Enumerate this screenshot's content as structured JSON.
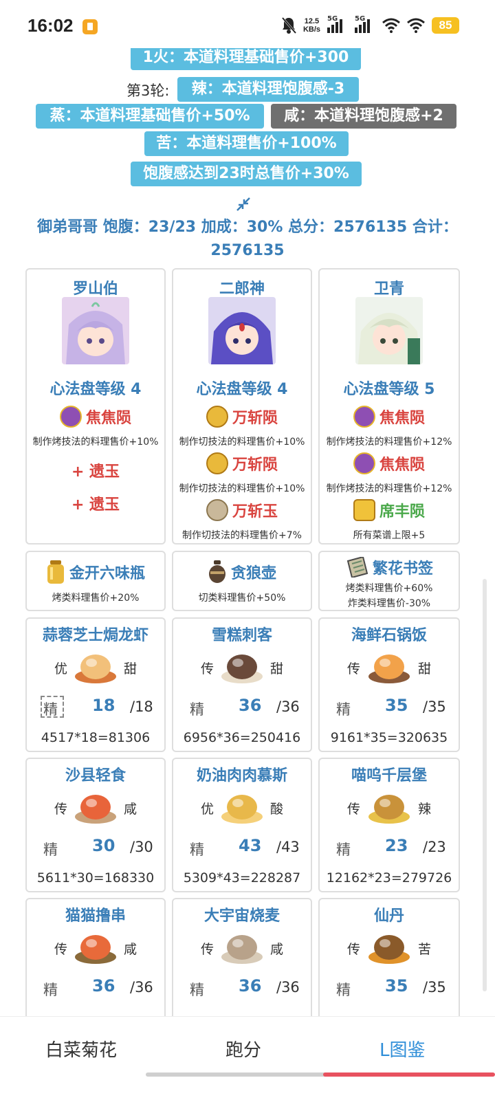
{
  "status": {
    "time": "16:02",
    "net_speed_top": "12.5",
    "net_speed_bottom": "KB/s",
    "sig1": "5G",
    "sig2": "5G",
    "battery": "85"
  },
  "tags": {
    "t1": "1火：本道料理基础售价+300",
    "round3_label": "第3轮:",
    "t2": "辣：本道料理饱腹感-3",
    "t3": "蒸：本道料理基础售价+50%",
    "t4": "咸：本道料理饱腹感+2",
    "t5": "苦：本道料理售价+100%",
    "t6": "饱腹感达到23时总售价+30%"
  },
  "summary": {
    "line1": "御弟哥哥 饱腹：23/23 加成：30% 总分：2576135 合计：",
    "line2": "2576135"
  },
  "chefs": [
    {
      "name": "罗山伯",
      "level": "心法盘等级 4",
      "equips": [
        {
          "name": "焦焦陨",
          "desc": "制作烤技法的料理售价+10%",
          "color": "#8e4fb3"
        }
      ],
      "plus1": "+ 遗玉",
      "plus2": "+ 遗玉"
    },
    {
      "name": "二郎神",
      "level": "心法盘等级 4",
      "equips": [
        {
          "name": "万斩陨",
          "desc": "制作切技法的料理售价+10%",
          "color": "#d9a21b"
        },
        {
          "name": "万斩陨",
          "desc": "制作切技法的料理售价+10%",
          "color": "#d9a21b"
        },
        {
          "name": "万斩玉",
          "desc": "制作切技法的料理售价+7%",
          "color": "#b9a07a"
        }
      ]
    },
    {
      "name": "卫青",
      "level": "心法盘等级 5",
      "equips": [
        {
          "name": "焦焦陨",
          "desc": "制作烤技法的料理售价+12%",
          "color": "#8e4fb3"
        },
        {
          "name": "焦焦陨",
          "desc": "制作烤技法的料理售价+12%",
          "color": "#8e4fb3"
        },
        {
          "name": "席丰陨",
          "desc": "所有菜谱上限+5",
          "color": "#e0a21b"
        }
      ]
    }
  ],
  "items": [
    {
      "name": "金开六味瓶",
      "desc1": "烤类料理售价+20%",
      "desc2": ""
    },
    {
      "name": "贪狼壶",
      "desc1": "切类料理售价+50%",
      "desc2": ""
    },
    {
      "name": "繁花书签",
      "desc1": "烤类料理售价+60%",
      "desc2": "炸类料理售价-30%"
    }
  ],
  "dishes": [
    {
      "name": "蒜蓉芝士焗龙虾",
      "left": "优",
      "right": "甜",
      "skill": "精",
      "count": "18",
      "max": "/18",
      "formula": "4517*18=81306"
    },
    {
      "name": "雪糕刺客",
      "left": "传",
      "right": "甜",
      "skill": "精",
      "count": "36",
      "max": "/36",
      "formula": "6956*36=250416"
    },
    {
      "name": "海鲜石锅饭",
      "left": "传",
      "right": "甜",
      "skill": "精",
      "count": "35",
      "max": "/35",
      "formula": "9161*35=320635"
    },
    {
      "name": "沙县轻食",
      "left": "传",
      "right": "咸",
      "skill": "精",
      "count": "30",
      "max": "/30",
      "formula": "5611*30=168330"
    },
    {
      "name": "奶油肉肉慕斯",
      "left": "优",
      "right": "酸",
      "skill": "精",
      "count": "43",
      "max": "/43",
      "formula": "5309*43=228287"
    },
    {
      "name": "喵呜千层堡",
      "left": "传",
      "right": "辣",
      "skill": "精",
      "count": "23",
      "max": "/23",
      "formula": "12162*23=279726"
    },
    {
      "name": "猫猫撸串",
      "left": "传",
      "right": "咸",
      "skill": "精",
      "count": "36",
      "max": "/36",
      "formula": ""
    },
    {
      "name": "大宇宙烧麦",
      "left": "传",
      "right": "咸",
      "skill": "精",
      "count": "36",
      "max": "/36",
      "formula": ""
    },
    {
      "name": "仙丹",
      "left": "传",
      "right": "苦",
      "skill": "精",
      "count": "35",
      "max": "/35",
      "formula": ""
    }
  ],
  "nav": {
    "tab1": "白菜菊花",
    "tab2": "跑分",
    "tab3": "L图鉴"
  }
}
